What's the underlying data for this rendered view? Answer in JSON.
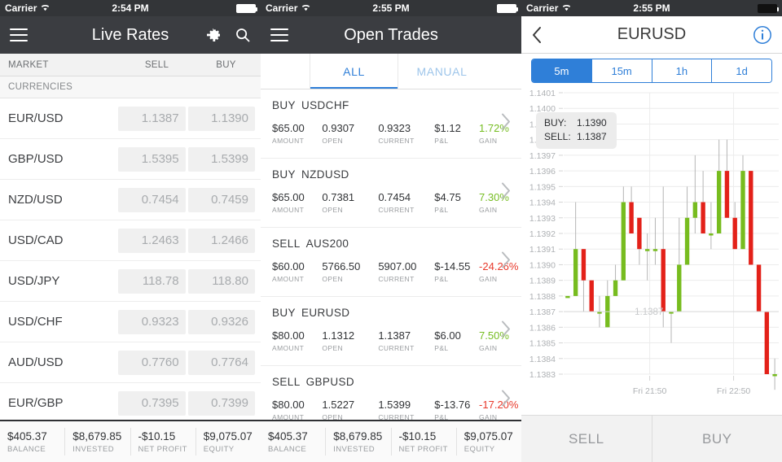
{
  "screens": {
    "live_rates": {
      "status": {
        "carrier": "Carrier",
        "time": "2:54 PM",
        "wifi_icon": "wifi-icon",
        "battery_icon": "battery-icon"
      },
      "nav": {
        "menu_icon": "hamburger-menu-icon",
        "title": "Live Rates",
        "settings_icon": "gear-icon",
        "search_icon": "search-icon"
      },
      "columns": {
        "market": "MARKET",
        "sell": "SELL",
        "buy": "BUY"
      },
      "section": "CURRENCIES",
      "rows": [
        {
          "market": "EUR/USD",
          "sell": "1.1387",
          "buy": "1.1390"
        },
        {
          "market": "GBP/USD",
          "sell": "1.5395",
          "buy": "1.5399"
        },
        {
          "market": "NZD/USD",
          "sell": "0.7454",
          "buy": "0.7459"
        },
        {
          "market": "USD/CAD",
          "sell": "1.2463",
          "buy": "1.2466"
        },
        {
          "market": "USD/JPY",
          "sell": "118.78",
          "buy": "118.80"
        },
        {
          "market": "USD/CHF",
          "sell": "0.9323",
          "buy": "0.9326"
        },
        {
          "market": "AUD/USD",
          "sell": "0.7760",
          "buy": "0.7764"
        },
        {
          "market": "EUR/GBP",
          "sell": "0.7395",
          "buy": "0.7399"
        }
      ],
      "summary": [
        {
          "value": "$405.37",
          "label": "BALANCE"
        },
        {
          "value": "$8,679.85",
          "label": "INVESTED"
        },
        {
          "value": "-$10.15",
          "label": "NET PROFIT"
        },
        {
          "value": "$9,075.07",
          "label": "EQUITY"
        }
      ]
    },
    "open_trades": {
      "status": {
        "carrier": "Carrier",
        "time": "2:55 PM",
        "wifi_icon": "wifi-icon",
        "battery_icon": "battery-icon"
      },
      "nav": {
        "menu_icon": "hamburger-menu-icon",
        "title": "Open Trades"
      },
      "tabs": [
        {
          "label": "ALL",
          "active": true
        },
        {
          "label": "MANUAL",
          "active": false
        }
      ],
      "metric_labels": {
        "amount": "AMOUNT",
        "open": "OPEN",
        "current": "CURRENT",
        "pl": "P&L",
        "gain": "GAIN"
      },
      "trades": [
        {
          "side": "BUY",
          "symbol": "USDCHF",
          "amount": "$65.00",
          "open": "0.9307",
          "current": "0.9323",
          "pl": "$1.12",
          "gain": "1.72%",
          "direction": "up"
        },
        {
          "side": "BUY",
          "symbol": "NZDUSD",
          "amount": "$65.00",
          "open": "0.7381",
          "current": "0.7454",
          "pl": "$4.75",
          "gain": "7.30%",
          "direction": "up"
        },
        {
          "side": "SELL",
          "symbol": "AUS200",
          "amount": "$60.00",
          "open": "5766.50",
          "current": "5907.00",
          "pl": "$-14.55",
          "gain": "-24.26%",
          "direction": "down"
        },
        {
          "side": "BUY",
          "symbol": "EURUSD",
          "amount": "$80.00",
          "open": "1.1312",
          "current": "1.1387",
          "pl": "$6.00",
          "gain": "7.50%",
          "direction": "up"
        },
        {
          "side": "SELL",
          "symbol": "GBPUSD",
          "amount": "$80.00",
          "open": "1.5227",
          "current": "1.5399",
          "pl": "$-13.76",
          "gain": "-17.20%",
          "direction": "down"
        }
      ],
      "summary": [
        {
          "value": "$405.37",
          "label": "BALANCE"
        },
        {
          "value": "$8,679.85",
          "label": "INVESTED"
        },
        {
          "value": "-$10.15",
          "label": "NET PROFIT"
        },
        {
          "value": "$9,075.07",
          "label": "EQUITY"
        }
      ],
      "chevron_icon": "chevron-right-icon"
    },
    "chart": {
      "status": {
        "carrier": "Carrier",
        "time": "2:55 PM",
        "wifi_icon": "wifi-icon",
        "battery_icon": "battery-icon"
      },
      "nav": {
        "back_icon": "chevron-left-icon",
        "title": "EURUSD",
        "info_icon": "info-icon"
      },
      "timeframes": [
        {
          "label": "5m",
          "active": true
        },
        {
          "label": "15m",
          "active": false
        },
        {
          "label": "1h",
          "active": false
        },
        {
          "label": "1d",
          "active": false
        }
      ],
      "tooltip": {
        "buy_label": "BUY:",
        "buy_value": "1.1390",
        "sell_label": "SELL:",
        "sell_value": "1.1387"
      },
      "price_line_label": "1.1387",
      "actions": {
        "sell": "SELL",
        "buy": "BUY"
      }
    }
  },
  "colors": {
    "navbar_dark": "#3b3d41",
    "statusbar": "#333538",
    "accent_blue": "#2f7fd8",
    "gain_green": "#76bd22",
    "loss_red": "#e8392b",
    "candle_up": "#77bc1f",
    "candle_down": "#e32119"
  },
  "chart_data": {
    "type": "candlestick",
    "title": "EURUSD",
    "timeframe": "5m",
    "ylabel": "",
    "xlabel": "",
    "ylim": [
      1.1383,
      1.1401
    ],
    "yticks": [
      "1.1401",
      "1.1400",
      "1.1399",
      "1.1398",
      "1.1397",
      "1.1396",
      "1.1395",
      "1.1394",
      "1.1393",
      "1.1392",
      "1.1391",
      "1.1390",
      "1.1389",
      "1.1388",
      "1.1387",
      "1.1386",
      "1.1385",
      "1.1384",
      "1.1383"
    ],
    "xticks": [
      "Fri 21:50",
      "Fri 22:50"
    ],
    "grid": true,
    "current_price": 1.1387,
    "candles": [
      {
        "o": 1.1388,
        "h": 1.1388,
        "l": 1.1388,
        "c": 1.1388,
        "dir": "up"
      },
      {
        "o": 1.1388,
        "h": 1.1394,
        "l": 1.1388,
        "c": 1.1391,
        "dir": "up"
      },
      {
        "o": 1.1391,
        "h": 1.1391,
        "l": 1.1387,
        "c": 1.1389,
        "dir": "down"
      },
      {
        "o": 1.1389,
        "h": 1.1389,
        "l": 1.1387,
        "c": 1.1387,
        "dir": "down"
      },
      {
        "o": 1.1387,
        "h": 1.1388,
        "l": 1.1386,
        "c": 1.1387,
        "dir": "up"
      },
      {
        "o": 1.1386,
        "h": 1.1389,
        "l": 1.1386,
        "c": 1.1388,
        "dir": "up"
      },
      {
        "o": 1.1388,
        "h": 1.139,
        "l": 1.1388,
        "c": 1.1389,
        "dir": "up"
      },
      {
        "o": 1.1389,
        "h": 1.1395,
        "l": 1.1389,
        "c": 1.1394,
        "dir": "up"
      },
      {
        "o": 1.1394,
        "h": 1.1395,
        "l": 1.1392,
        "c": 1.1392,
        "dir": "down"
      },
      {
        "o": 1.1393,
        "h": 1.1393,
        "l": 1.139,
        "c": 1.1391,
        "dir": "down"
      },
      {
        "o": 1.1391,
        "h": 1.1392,
        "l": 1.1389,
        "c": 1.1391,
        "dir": "up"
      },
      {
        "o": 1.1391,
        "h": 1.1393,
        "l": 1.139,
        "c": 1.1391,
        "dir": "up"
      },
      {
        "o": 1.1391,
        "h": 1.1395,
        "l": 1.1386,
        "c": 1.1387,
        "dir": "down"
      },
      {
        "o": 1.1387,
        "h": 1.1387,
        "l": 1.1385,
        "c": 1.1387,
        "dir": "up"
      },
      {
        "o": 1.1387,
        "h": 1.1393,
        "l": 1.1387,
        "c": 1.139,
        "dir": "up"
      },
      {
        "o": 1.139,
        "h": 1.1395,
        "l": 1.139,
        "c": 1.1393,
        "dir": "up"
      },
      {
        "o": 1.1393,
        "h": 1.1397,
        "l": 1.1392,
        "c": 1.1394,
        "dir": "up"
      },
      {
        "o": 1.1394,
        "h": 1.1396,
        "l": 1.1392,
        "c": 1.1392,
        "dir": "down"
      },
      {
        "o": 1.1392,
        "h": 1.1394,
        "l": 1.1391,
        "c": 1.1392,
        "dir": "up"
      },
      {
        "o": 1.1392,
        "h": 1.1398,
        "l": 1.1392,
        "c": 1.1396,
        "dir": "up"
      },
      {
        "o": 1.1396,
        "h": 1.1398,
        "l": 1.1393,
        "c": 1.1393,
        "dir": "down"
      },
      {
        "o": 1.1393,
        "h": 1.1394,
        "l": 1.1391,
        "c": 1.1391,
        "dir": "down"
      },
      {
        "o": 1.1391,
        "h": 1.1397,
        "l": 1.1391,
        "c": 1.1396,
        "dir": "up"
      },
      {
        "o": 1.1396,
        "h": 1.1396,
        "l": 1.139,
        "c": 1.139,
        "dir": "down"
      },
      {
        "o": 1.139,
        "h": 1.139,
        "l": 1.1387,
        "c": 1.1387,
        "dir": "down"
      },
      {
        "o": 1.1387,
        "h": 1.1387,
        "l": 1.1383,
        "c": 1.1383,
        "dir": "down"
      },
      {
        "o": 1.1383,
        "h": 1.1384,
        "l": 1.1382,
        "c": 1.1383,
        "dir": "up"
      }
    ]
  }
}
